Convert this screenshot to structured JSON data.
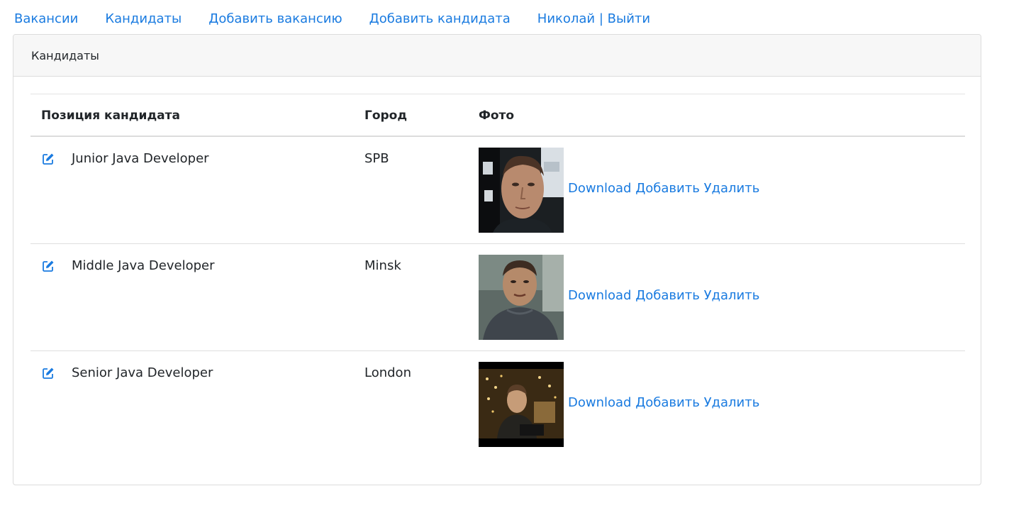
{
  "nav": {
    "items": [
      {
        "label": "Вакансии"
      },
      {
        "label": "Кандидаты"
      },
      {
        "label": "Добавить вакансию"
      },
      {
        "label": "Добавить кандидата"
      },
      {
        "label": "Николай | Выйти"
      }
    ],
    "link_color": "#1a7be0"
  },
  "card": {
    "title": "Кандидаты"
  },
  "table": {
    "headers": {
      "position": "Позиция кандидата",
      "city": "Город",
      "photo": "Фото"
    },
    "rows": [
      {
        "position": "Junior Java Developer",
        "city": "SPB",
        "photo_icon": "candidate-photo",
        "download": "Download",
        "add": "Добавить",
        "delete": "Удалить"
      },
      {
        "position": "Middle Java Developer",
        "city": "Minsk",
        "photo_icon": "candidate-photo",
        "download": "Download",
        "add": "Добавить",
        "delete": "Удалить"
      },
      {
        "position": "Senior Java Developer",
        "city": "London",
        "photo_icon": "candidate-photo",
        "download": "Download",
        "add": "Добавить",
        "delete": "Удалить"
      }
    ]
  }
}
